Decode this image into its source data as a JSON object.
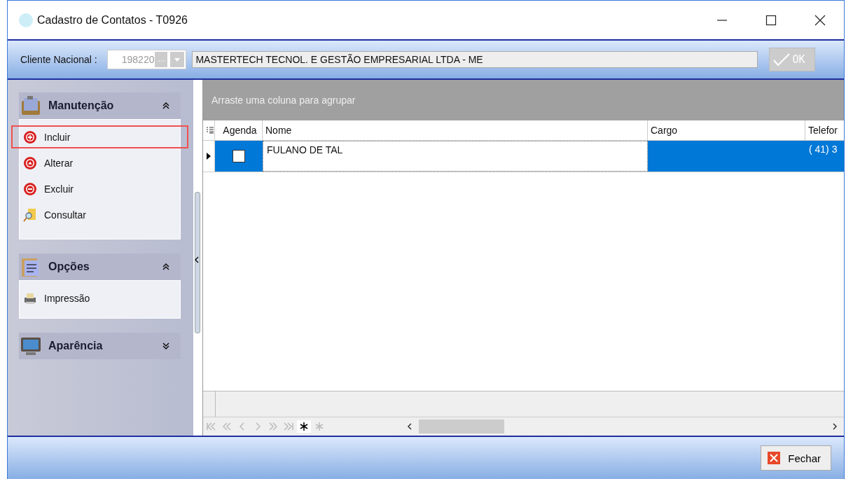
{
  "window": {
    "title": "Cadastro de Contatos - T0926"
  },
  "client": {
    "label": "Cliente Nacional :",
    "code": "198220",
    "ellipsis": "...",
    "name": "MASTERTECH TECNOL. E GESTÃO EMPRESARIAL LTDA - ME",
    "ok_button": {
      "label": "OK",
      "disabled": true
    }
  },
  "sidebar": {
    "groups": [
      {
        "title": "Manutenção",
        "kind": "calendar",
        "expanded": true,
        "items": [
          {
            "label": "Incluir",
            "kind": "add",
            "selected": true
          },
          {
            "label": "Alterar",
            "kind": "edit",
            "selected": false
          },
          {
            "label": "Excluir",
            "kind": "delete",
            "selected": false
          },
          {
            "label": "Consultar",
            "kind": "search",
            "selected": false
          }
        ]
      },
      {
        "title": "Opções",
        "kind": "clipboard",
        "expanded": true,
        "items": [
          {
            "label": "Impressão",
            "kind": "print",
            "selected": false
          }
        ]
      },
      {
        "title": "Aparência",
        "kind": "monitor",
        "expanded": false
      }
    ]
  },
  "grid": {
    "group_panel": "Arraste uma coluna para agrupar",
    "columns": [
      "Agenda",
      "Nome",
      "Cargo",
      "Telefor"
    ],
    "rows": [
      {
        "selected": true,
        "agenda_checked": false,
        "nome": "FULANO DE TAL",
        "telefone": "( 41) 3"
      }
    ]
  },
  "footer": {
    "close_button": "Fechar"
  }
}
